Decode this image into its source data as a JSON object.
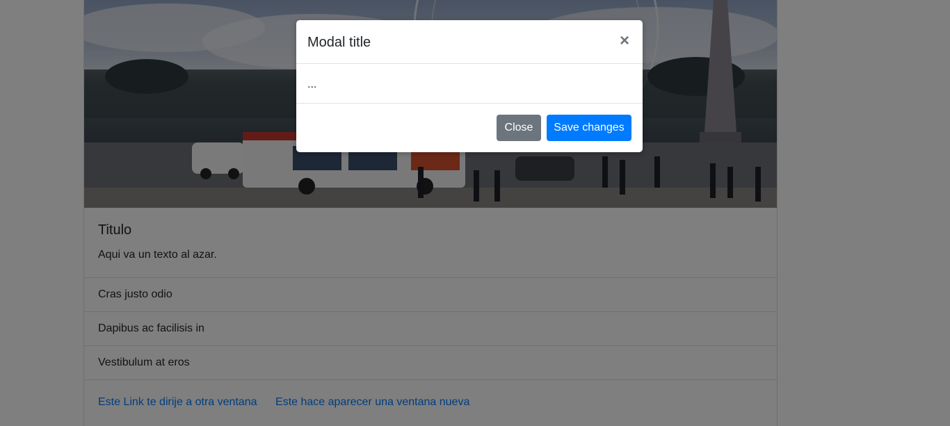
{
  "card": {
    "image_alt": "Place de la Concorde photo",
    "title": "Titulo",
    "text": "Aqui va un texto al azar.",
    "list_items": [
      "Cras justo odio",
      "Dapibus ac facilisis in",
      "Vestibulum at eros"
    ],
    "links": [
      "Este Link te dirije a otra ventana",
      "Este hace aparecer una ventana nueva"
    ]
  },
  "modal": {
    "title": "Modal title",
    "close_icon": "×",
    "body": "...",
    "close_button": "Close",
    "save_button": "Save changes"
  },
  "colors": {
    "primary": "#007bff",
    "secondary": "#6c757d",
    "backdrop": "rgba(0,0,0,0.5)"
  }
}
